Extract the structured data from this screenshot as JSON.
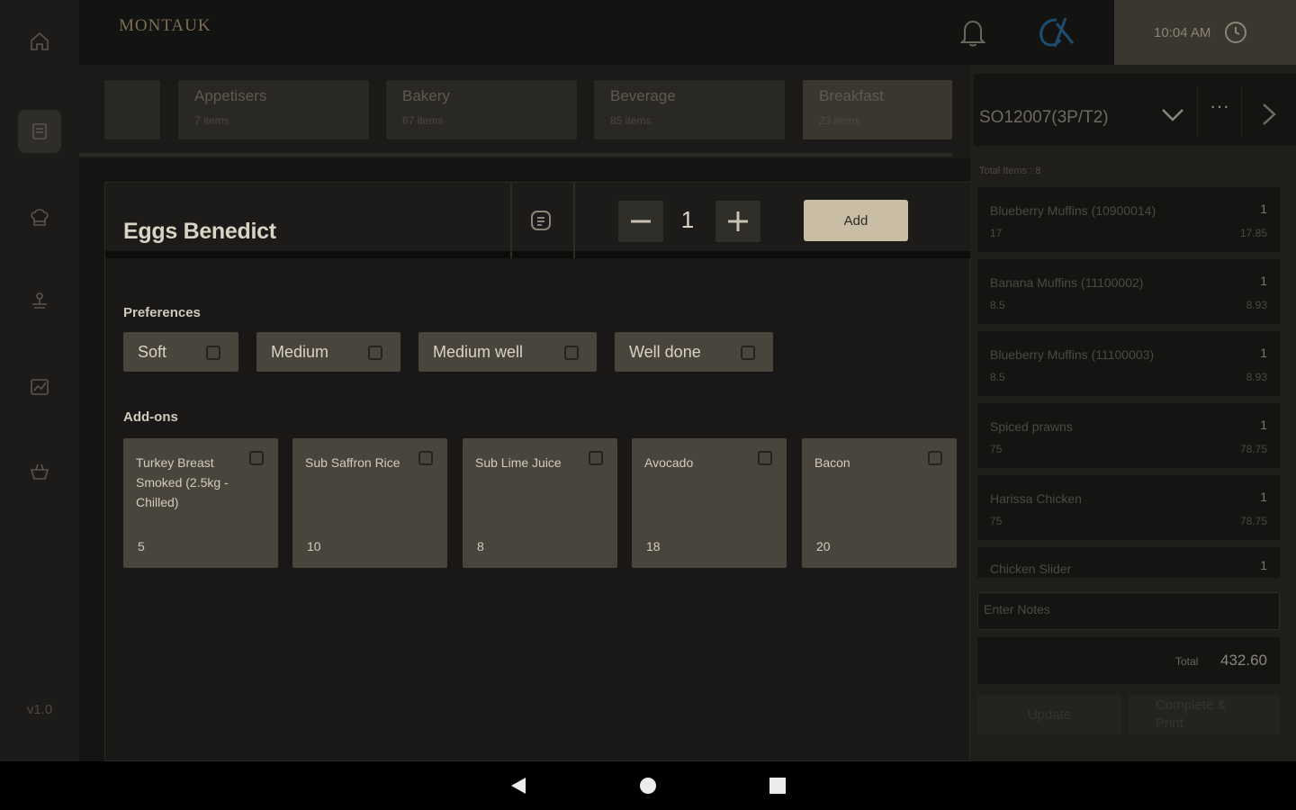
{
  "sidebar": {
    "items": [
      {
        "icon": "home-icon"
      },
      {
        "icon": "menu-list-icon"
      },
      {
        "icon": "chef-hat-icon"
      },
      {
        "icon": "serving-tray-icon"
      },
      {
        "icon": "reports-icon"
      },
      {
        "icon": "basket-icon"
      }
    ],
    "version": "v1.0"
  },
  "header": {
    "brand": "MONTAUK",
    "time": "10:04 AM"
  },
  "categories": [
    {
      "name": "",
      "count": ""
    },
    {
      "name": "Appetisers",
      "count": "7 items"
    },
    {
      "name": "Bakery",
      "count": "67 items"
    },
    {
      "name": "Beverage",
      "count": "85 items"
    },
    {
      "name": "Breakfast",
      "count": "23 items"
    }
  ],
  "item": {
    "title": "Eggs Benedict",
    "quantity": "1",
    "add_label": "Add",
    "preferences_label": "Preferences",
    "preferences": [
      "Soft",
      "Medium",
      "Medium well",
      "Well done"
    ],
    "addons_label": "Add-ons",
    "addons": [
      {
        "name": "Turkey Breast Smoked (2.5kg - Chilled)",
        "price": "5"
      },
      {
        "name": "Sub Saffron Rice",
        "price": "10"
      },
      {
        "name": "Sub Lime Juice",
        "price": "8"
      },
      {
        "name": "Avocado",
        "price": "18"
      },
      {
        "name": "Bacon",
        "price": "20"
      }
    ]
  },
  "cart": {
    "order_id": "SO12007(3P/T2)",
    "more_label": "···",
    "total_items": "Total Items : 8",
    "lines": [
      {
        "name": "Blueberry Muffins (10900014)",
        "qty": "1",
        "price": "17",
        "total": "17.85"
      },
      {
        "name": "Banana Muffins (11100002)",
        "qty": "1",
        "price": "8.5",
        "total": "8.93"
      },
      {
        "name": "Blueberry Muffins (11100003)",
        "qty": "1",
        "price": "8.5",
        "total": "8.93"
      },
      {
        "name": "Spiced prawns",
        "qty": "1",
        "price": "75",
        "total": "78.75"
      },
      {
        "name": "Harissa Chicken",
        "qty": "1",
        "price": "75",
        "total": "78.75"
      },
      {
        "name": "Chicken Slider",
        "qty": "1",
        "price": "",
        "total": ""
      }
    ],
    "notes_placeholder": "Enter Notes",
    "total_label": "Total",
    "total_value": "432.60",
    "update_label": "Update",
    "complete_label": "Complete & Print"
  },
  "colors": {
    "accent": "#c9bea5",
    "background": "#141412",
    "chip": "#49453d"
  }
}
